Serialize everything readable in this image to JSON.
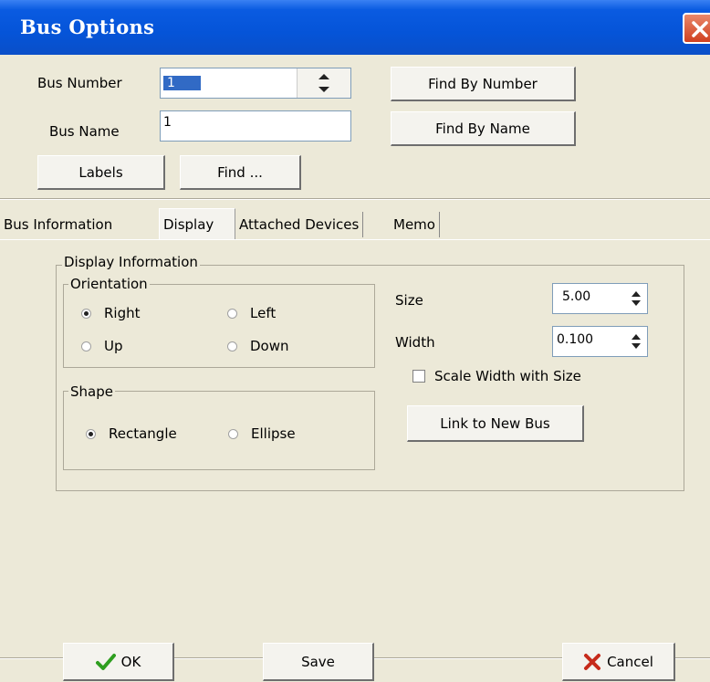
{
  "window": {
    "title": "Bus Options"
  },
  "top": {
    "bus_number_label": "Bus Number",
    "bus_number_value": "1",
    "bus_name_label": "Bus Name",
    "bus_name_value": "1",
    "find_by_number": "Find By Number",
    "find_by_name": "Find By Name",
    "labels_button": "Labels",
    "find_button": "Find ..."
  },
  "tabs": [
    {
      "label": "Bus Information",
      "active": false
    },
    {
      "label": "Display",
      "active": true
    },
    {
      "label": "Attached Devices",
      "active": false
    },
    {
      "label": "Memo",
      "active": false
    }
  ],
  "display": {
    "group_title": "Display Information",
    "orientation": {
      "title": "Orientation",
      "options": [
        "Right",
        "Left",
        "Up",
        "Down"
      ],
      "selected": "Right"
    },
    "shape": {
      "title": "Shape",
      "options": [
        "Rectangle",
        "Ellipse"
      ],
      "selected": "Rectangle"
    },
    "size_label": "Size",
    "size_value": "5.00",
    "width_label": "Width",
    "width_value": "0.100",
    "scale_checkbox_label": "Scale Width with Size",
    "scale_checked": false,
    "link_button": "Link to New Bus"
  },
  "footer": {
    "ok": "OK",
    "save": "Save",
    "cancel": "Cancel"
  },
  "colors": {
    "titlebar": "#0554D8",
    "dialog_bg": "#ECE9D8",
    "ok_check": "#2E9E1F",
    "cancel_x": "#C62A1A"
  }
}
